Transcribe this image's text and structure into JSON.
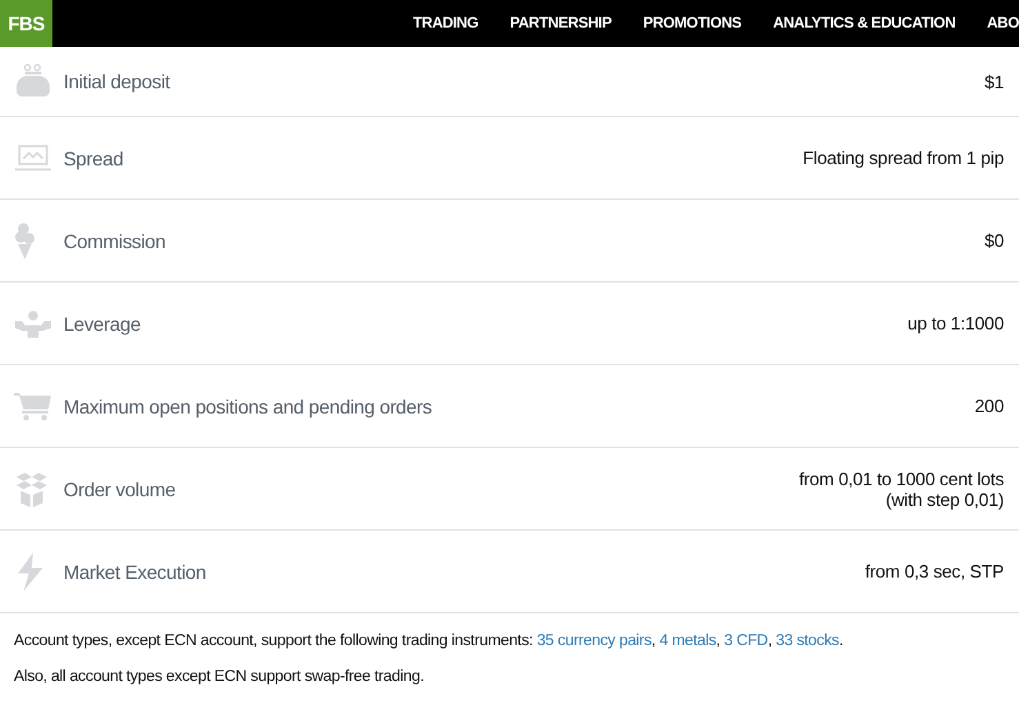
{
  "header": {
    "logo": "FBS",
    "nav": [
      {
        "label": "TRADING"
      },
      {
        "label": "PARTNERSHIP"
      },
      {
        "label": "PROMOTIONS"
      },
      {
        "label": "ANALYTICS & EDUCATION"
      },
      {
        "label": "ABO"
      }
    ]
  },
  "rows": [
    {
      "kind": "wallet",
      "label": "Initial deposit",
      "value": [
        "$1"
      ]
    },
    {
      "kind": "laptop",
      "label": "Spread",
      "value": [
        "Floating spread from 1 pip"
      ]
    },
    {
      "kind": "icecream",
      "label": "Commission",
      "value": [
        "$0"
      ]
    },
    {
      "kind": "strongman",
      "label": "Leverage",
      "value": [
        "up to 1:1000"
      ]
    },
    {
      "kind": "cart",
      "label": "Maximum open positions and pending orders",
      "value": [
        "200"
      ]
    },
    {
      "kind": "box",
      "label": "Order volume",
      "value": [
        "from 0,01 to 1000 cent lots",
        "(with step 0,01)"
      ]
    },
    {
      "kind": "lightning",
      "label": "Market Execution",
      "value": [
        "from 0,3 sec, STP"
      ]
    }
  ],
  "notes": [
    {
      "parts": [
        {
          "kind": "text",
          "text": "Account types, except ECN account, support the following trading instruments: "
        },
        {
          "kind": "link",
          "text": "35 currency pairs"
        },
        {
          "kind": "text",
          "text": ", "
        },
        {
          "kind": "link",
          "text": "4 metals"
        },
        {
          "kind": "text",
          "text": ", "
        },
        {
          "kind": "link",
          "text": "3 CFD"
        },
        {
          "kind": "text",
          "text": ", "
        },
        {
          "kind": "link",
          "text": "33 stocks"
        },
        {
          "kind": "text",
          "text": "."
        }
      ]
    },
    {
      "parts": [
        {
          "kind": "text",
          "text": "Also, all account types except ECN support swap-free trading."
        }
      ]
    }
  ]
}
